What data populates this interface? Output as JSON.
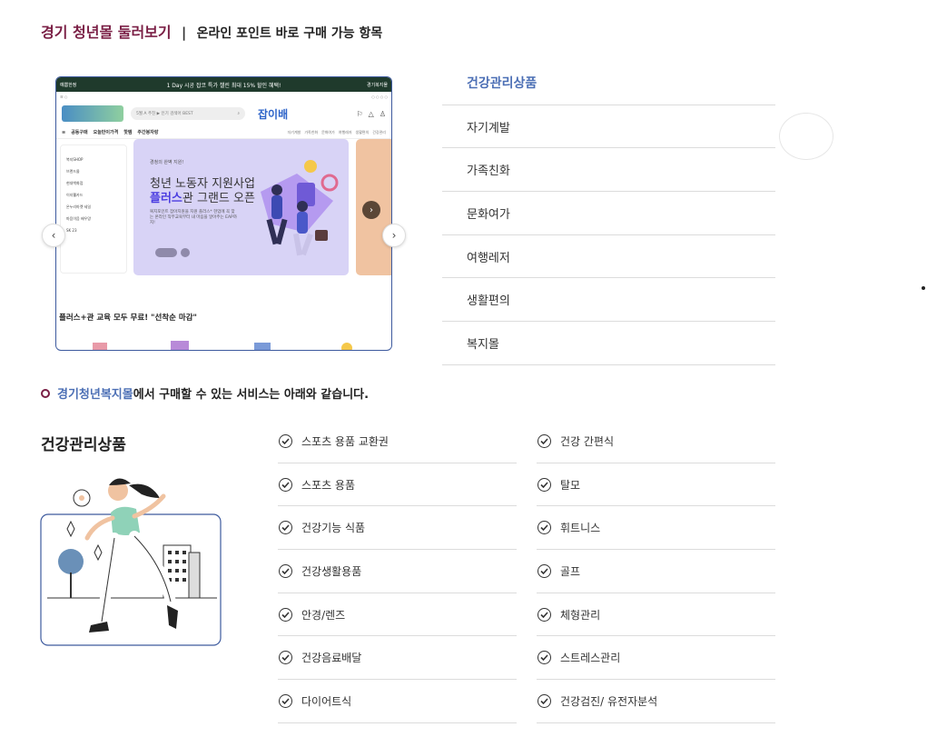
{
  "header": {
    "title": "경기 청년몰 둘러보기",
    "separator": "|",
    "subtitle": "온라인 포인트 바로 구매 가능 항목"
  },
  "preview": {
    "topbar": "1 Day 시공 잡코 특가 챌린 최대 15% 할인 혜택!",
    "topbar_left": "예쁨한정",
    "topbar_right": "경기복지몰",
    "search_placeholder": "5월 A 주친 ▶ 인기 검색어 BEST",
    "brand": "잡이배",
    "nav": [
      "공동구매",
      "오늘만이가격",
      "핫템",
      "주간봉자랑"
    ],
    "nav_sub": [
      "자기계발",
      "가족친화",
      "문화여가",
      "여행레저",
      "생활편의",
      "건강관리"
    ],
    "side_items": [
      "복지SHOP",
      "브랜드몰",
      "현대백화점",
      "이지웰카드",
      "온누리마켓 세일",
      "마음이음 배우망",
      "SK 23"
    ],
    "banner_tag": "경청의 완벽 지원!",
    "banner_line1": "청년 노동자 지원사업",
    "banner_line2_accent": "플러스",
    "banner_line2_rest": "관 그랜드 오픈",
    "banner_desc": "복지포인트 잡아지원을 지원 플러스* 현업에 꼭 맞는 온라인 직무교육부터 내 마음을 알아주는 EAP까지!",
    "caption": "플러스+관 교육 모두 무료! \"선착순 마감\""
  },
  "categories": [
    {
      "label": "건강관리상품",
      "active": true
    },
    {
      "label": "자기계발",
      "active": false
    },
    {
      "label": "가족친화",
      "active": false
    },
    {
      "label": "문화여가",
      "active": false
    },
    {
      "label": "여행레저",
      "active": false
    },
    {
      "label": "생활편의",
      "active": false
    },
    {
      "label": "복지몰",
      "active": false
    }
  ],
  "intro": {
    "highlight": "경기청년복지몰",
    "rest": "에서 구매할 수 있는 서비스는 아래와 같습니다."
  },
  "section": {
    "title": "건강관리상품"
  },
  "services_left": [
    "스포츠 용품 교환권",
    "스포츠 용품",
    "건강기능 식품",
    "건강생활용품",
    "안경/렌즈",
    "건강음료배달",
    "다이어트식"
  ],
  "services_right": [
    "건강 간편식",
    "탈모",
    "휘트니스",
    "골프",
    "체형관리",
    "스트레스관리",
    "건강검진/ 유전자분석"
  ],
  "colors": {
    "brand": "#7a1f45",
    "accent": "#4c6fb5",
    "preview_border": "#3d5a9e"
  }
}
